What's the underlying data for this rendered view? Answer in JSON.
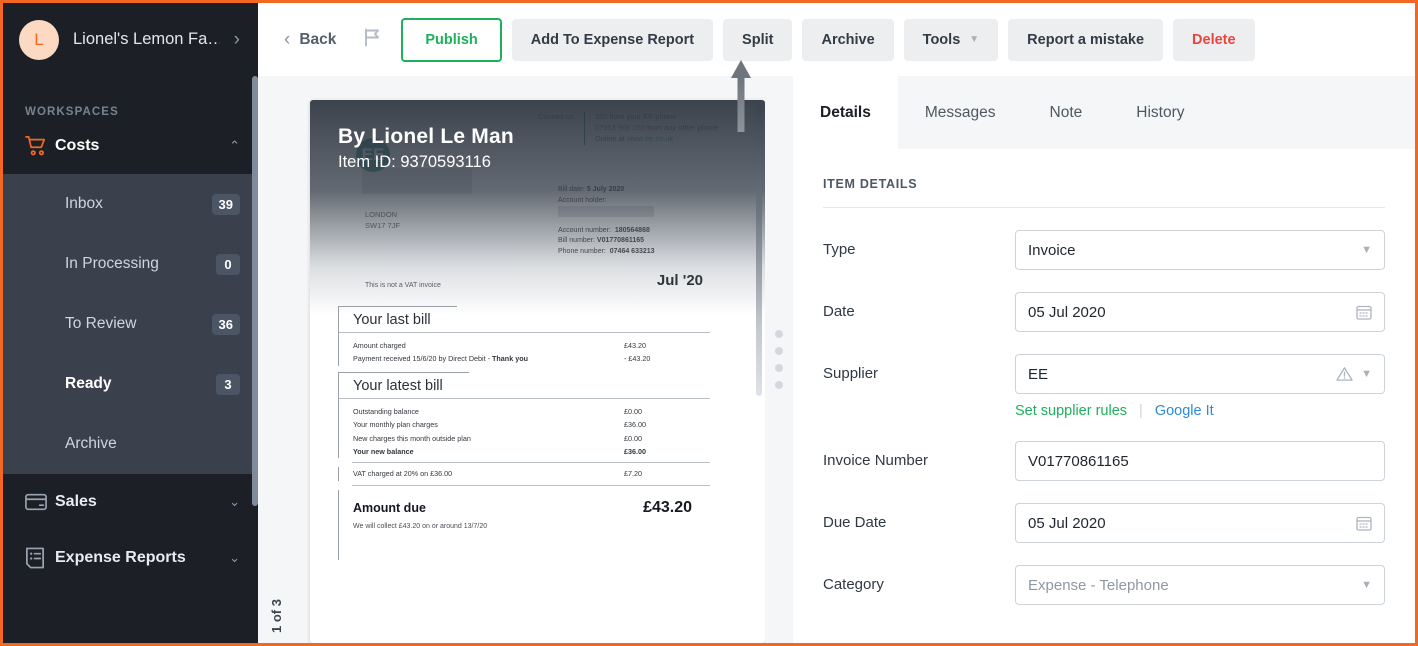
{
  "theme": {
    "accent_orange": "#f26722",
    "green": "#1eb05a",
    "blue": "#2e8bd6",
    "red": "#e8453c",
    "teal": "#1c7f7f"
  },
  "sidebar": {
    "workspace": {
      "initial": "L",
      "name": "Lionel's Lemon Fa…",
      "chevron": "›"
    },
    "section_label": "WORKSPACES",
    "groups": [
      {
        "label": "Costs",
        "icon": "cart-icon",
        "expanded": true,
        "chevron": "⌃",
        "items": [
          {
            "label": "Inbox",
            "badge": "39",
            "active": false
          },
          {
            "label": "In Processing",
            "badge": "0",
            "active": false
          },
          {
            "label": "To Review",
            "badge": "36",
            "active": false
          },
          {
            "label": "Ready",
            "badge": "3",
            "active": true
          },
          {
            "label": "Archive",
            "badge": "",
            "active": false
          }
        ]
      },
      {
        "label": "Sales",
        "icon": "card-icon",
        "expanded": false,
        "chevron": "⌄",
        "items": []
      },
      {
        "label": "Expense Reports",
        "icon": "receipt-icon",
        "expanded": false,
        "chevron": "⌄",
        "items": []
      }
    ]
  },
  "toolbar": {
    "back_label": "Back",
    "back_chevron": "‹",
    "flag_icon": "flag-icon",
    "buttons": [
      {
        "label": "Publish",
        "style": "publish"
      },
      {
        "label": "Add To Expense Report",
        "style": "default"
      },
      {
        "label": "Split",
        "style": "default"
      },
      {
        "label": "Archive",
        "style": "default"
      },
      {
        "label": "Tools",
        "style": "default",
        "caret": "▼"
      },
      {
        "label": "Report a mistake",
        "style": "default"
      },
      {
        "label": "Delete",
        "style": "delete"
      }
    ]
  },
  "document": {
    "page_indicator": "1 of 3",
    "overlay_title": "By Lionel Le Man",
    "overlay_subtitle": "Item ID: 9370593116",
    "logo_text": "EE",
    "contact": {
      "label": "Contact us",
      "line1_num": "150",
      "line1_rest": " from your EE phone",
      "line2_num": "07953 966 250",
      "line2_rest": " from any other phone",
      "line3_pre": "Online at ",
      "line3_link": "www.ee.co.uk"
    },
    "meta": {
      "bill_date_label": "Bill date:",
      "bill_date_value": "5 July 2020",
      "account_holder_label": "Account holder:",
      "account_number_label": "Account number:",
      "account_number_value": "180564868",
      "bill_number_label": "Bill number:",
      "bill_number_value": "V01770861165",
      "phone_number_label": "Phone number:",
      "phone_number_value": "07464 633213"
    },
    "address": {
      "city": "LONDON",
      "postcode": "SW17 7JF"
    },
    "not_vat": "This is not a VAT invoice",
    "month": "Jul '20",
    "last_bill": {
      "heading": "Your last bill",
      "rows": [
        {
          "label": "Amount charged",
          "value": "£43.20",
          "bold": false
        },
        {
          "label": "Payment received 15/6/20 by Direct Debit - ",
          "label_bold": "Thank you",
          "value": "- £43.20",
          "bold": false
        }
      ]
    },
    "latest_bill": {
      "heading": "Your latest bill",
      "rows": [
        {
          "label": "Outstanding balance",
          "value": "£0.00",
          "bold": false
        },
        {
          "label": "Your monthly plan charges",
          "value": "£36.00",
          "bold": false
        },
        {
          "label": "New charges this month outside plan",
          "value": "£0.00",
          "bold": false
        },
        {
          "label": "Your new balance",
          "value": "£36.00",
          "bold": true
        }
      ],
      "vat_label": "VAT charged at   20% on £36.00",
      "vat_value": "£7.20"
    },
    "amount_due_label": "Amount due",
    "amount_due_value": "£43.20",
    "collect_note": "We will collect £43.20 on or around 13/7/20"
  },
  "details": {
    "tabs": [
      {
        "label": "Details",
        "active": true
      },
      {
        "label": "Messages",
        "active": false
      },
      {
        "label": "Note",
        "active": false
      },
      {
        "label": "History",
        "active": false
      }
    ],
    "section_title": "ITEM DETAILS",
    "fields": [
      {
        "label": "Type",
        "value": "Invoice",
        "control": "select",
        "placeholder": ""
      },
      {
        "label": "Date",
        "value": "05 Jul 2020",
        "control": "date",
        "placeholder": ""
      },
      {
        "label": "Supplier",
        "value": "EE",
        "control": "select-warn",
        "placeholder": ""
      },
      {
        "label": "Invoice Number",
        "value": "V01770861165",
        "control": "text",
        "placeholder": ""
      },
      {
        "label": "Due Date",
        "value": "05 Jul 2020",
        "control": "date",
        "placeholder": ""
      },
      {
        "label": "Category",
        "value": "Expense - Telephone",
        "control": "select",
        "placeholder": "",
        "muted": true
      }
    ],
    "supplier_links": {
      "set_rules": "Set supplier rules",
      "divider": "|",
      "google": "Google It"
    }
  }
}
